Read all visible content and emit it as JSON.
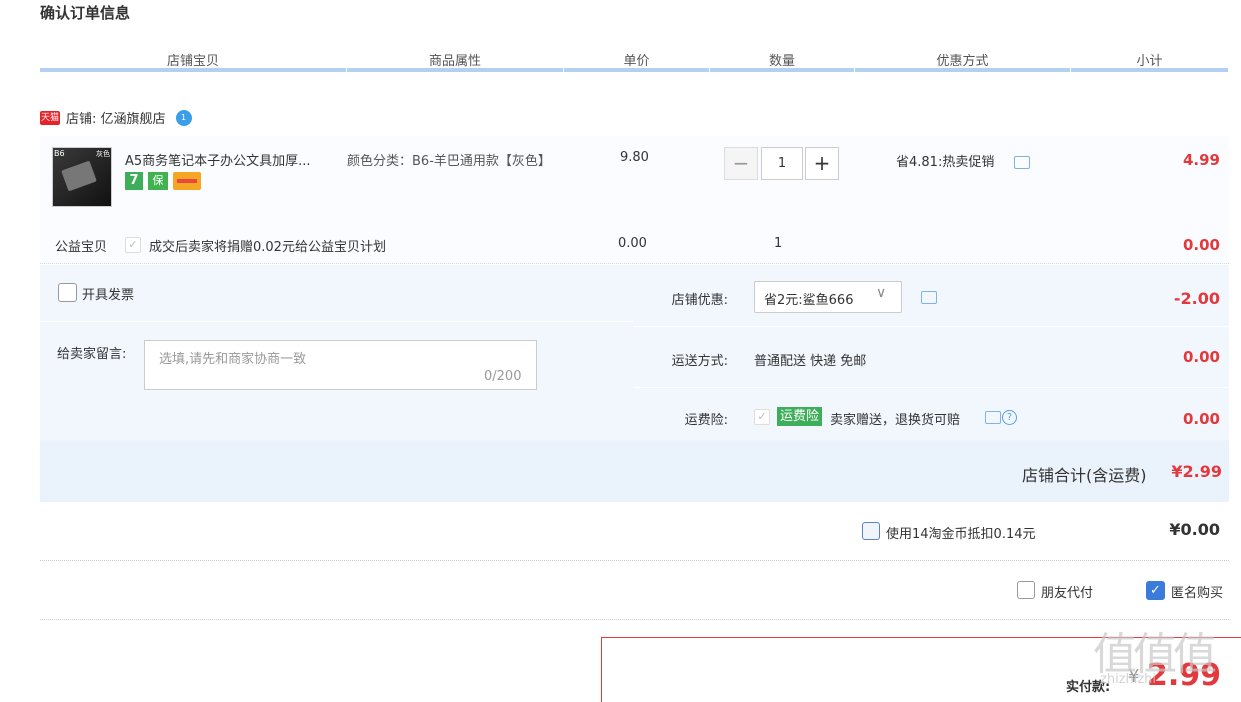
{
  "page": {
    "title": "确认订单信息"
  },
  "columns": {
    "item": "店铺宝贝",
    "attr": "商品属性",
    "price": "单价",
    "qty": "数量",
    "discount": "优惠方式",
    "subtotal": "小计"
  },
  "shop": {
    "badge": "天猫",
    "name": "店铺: 亿涵旗舰店",
    "ww_badge": "1"
  },
  "item": {
    "thumb_tag1": "B6",
    "thumb_tag2": "灰色",
    "name": "A5商务笔记本子办公文具加厚...",
    "badge1": "7",
    "badge2": "保",
    "attr": "颜色分类：B6-羊巴通用款【灰色】",
    "price": "9.80",
    "qty_minus": "−",
    "qty": "1",
    "qty_plus": "+",
    "promo": "省4.81:热卖促销",
    "subtotal": "4.99"
  },
  "charity": {
    "label": "公益宝贝",
    "check": "✓",
    "text": "成交后卖家将捐赠0.02元给公益宝贝计划",
    "price": "0.00",
    "qty": "1",
    "subtotal": "0.00"
  },
  "invoice": {
    "label": "开具发票"
  },
  "message": {
    "label": "给卖家留言:",
    "placeholder": "选填,请先和商家协商一致",
    "count": "0/200"
  },
  "shop_discount": {
    "label": "店铺优惠:",
    "selected": "省2元:鲨鱼666",
    "arrow": "∨",
    "value": "-2.00"
  },
  "shipping": {
    "label": "运送方式:",
    "text": "普通配送 快递 免邮",
    "value": "0.00"
  },
  "insurance": {
    "label": "运费险:",
    "check": "✓",
    "badge": "运费险",
    "text": "卖家赠送，退换货可赔",
    "help": "?",
    "value": "0.00"
  },
  "shop_total": {
    "label": "店铺合计(含运费)",
    "value": "¥2.99"
  },
  "coins": {
    "text": "使用14淘金币抵扣0.14元",
    "value": "¥0.00"
  },
  "options": {
    "friend_pay": "朋友代付",
    "anon_check": "✓",
    "anonymous": "匿名购买"
  },
  "payment": {
    "label": "实付款:",
    "currency": "¥",
    "value": "2.99"
  },
  "watermark": {
    "big": "值值值",
    "small": "zhizhizhi"
  },
  "colors": {
    "accent_red": "#e4393c",
    "header_bar": "#b2d1f2",
    "panel_bg": "#f2f7fd",
    "badge_green": "#3fae5a",
    "checkbox_blue": "#3b7bd9"
  }
}
